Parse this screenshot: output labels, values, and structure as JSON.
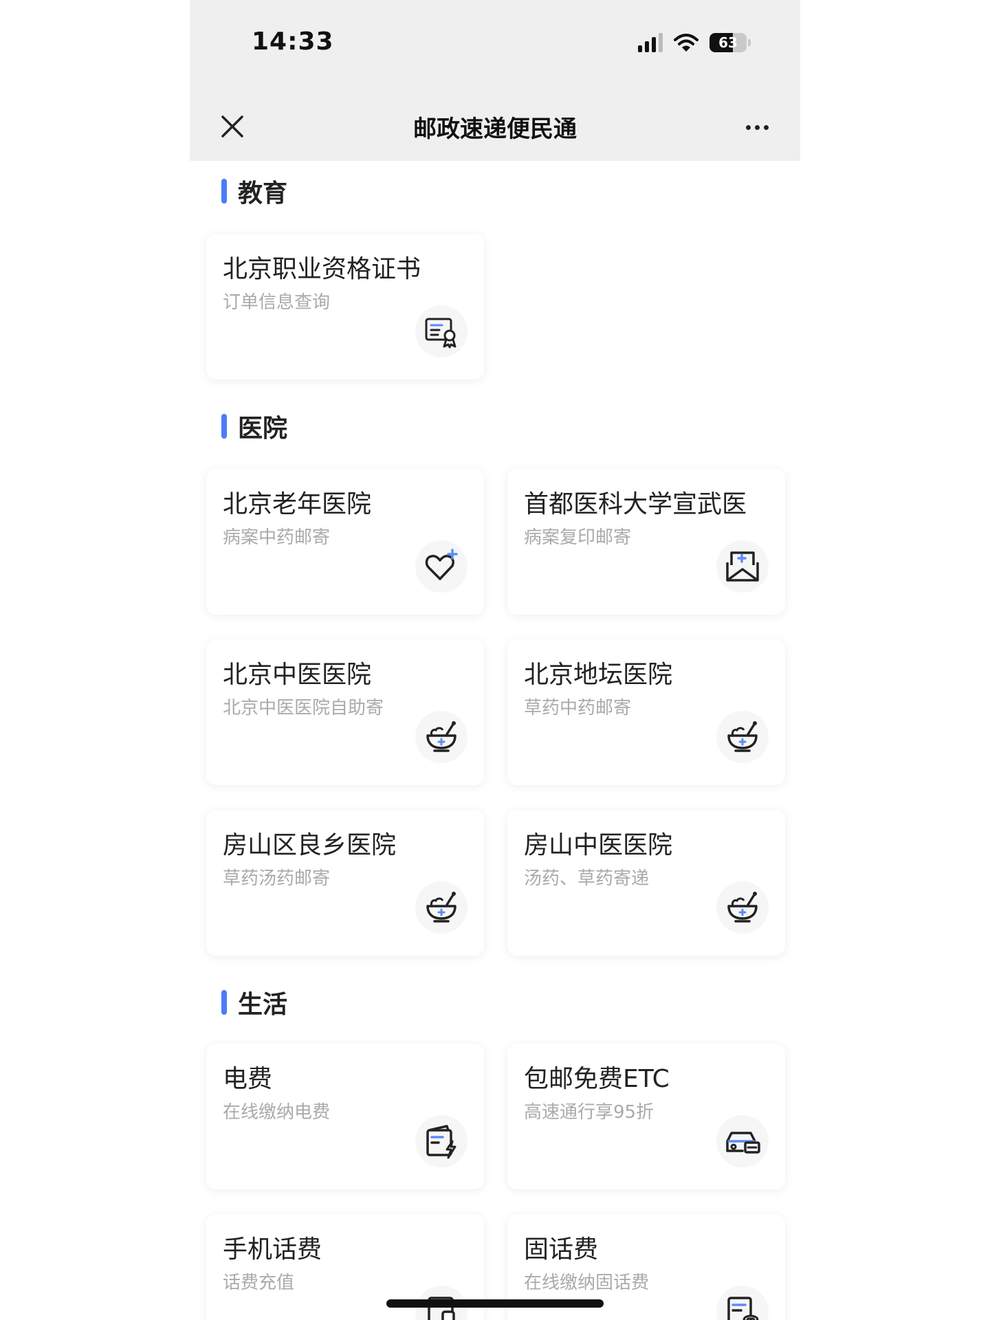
{
  "status_bar": {
    "time": "14:33",
    "battery": "63"
  },
  "nav": {
    "title": "邮政速递便民通"
  },
  "sections": {
    "education": {
      "title": "教育",
      "cards": [
        {
          "title": "北京职业资格证书",
          "subtitle": "订单信息查询",
          "icon": "certificate-icon"
        }
      ]
    },
    "hospital": {
      "title": "医院",
      "cards": [
        {
          "title": "北京老年医院",
          "subtitle": "病案中药邮寄",
          "icon": "heart-plus-icon"
        },
        {
          "title": "首都医科大学宣武医",
          "subtitle": "病案复印邮寄",
          "icon": "medical-mail-icon"
        },
        {
          "title": "北京中医医院",
          "subtitle": "北京中医医院自助寄",
          "icon": "herbal-bowl-icon"
        },
        {
          "title": "北京地坛医院",
          "subtitle": "草药中药邮寄",
          "icon": "herbal-bowl-icon"
        },
        {
          "title": "房山区良乡医院",
          "subtitle": "草药汤药邮寄",
          "icon": "herbal-bowl-icon"
        },
        {
          "title": "房山中医医院",
          "subtitle": "汤药、草药寄递",
          "icon": "herbal-bowl-icon"
        }
      ]
    },
    "life": {
      "title": "生活",
      "cards": [
        {
          "title": "电费",
          "subtitle": "在线缴纳电费",
          "icon": "electric-bill-icon"
        },
        {
          "title": "包邮免费ETC",
          "subtitle": "高速通行享95折",
          "icon": "car-etc-icon"
        },
        {
          "title": "手机话费",
          "subtitle": "话费充值",
          "icon": "phone-bill-icon"
        },
        {
          "title": "固话费",
          "subtitle": "在线缴纳固话费",
          "icon": "landline-bill-icon"
        }
      ]
    }
  },
  "colors": {
    "accent": "#4a7cf6",
    "icon_accent": "#5b8cf7",
    "icon_stroke": "#222222",
    "subtitle": "#aaaaaa",
    "topbar_bg": "#efefef"
  }
}
